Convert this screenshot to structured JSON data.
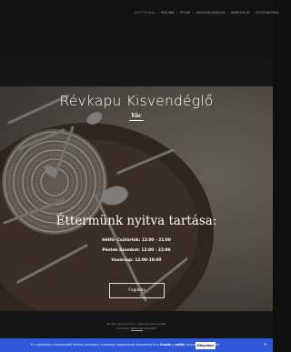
{
  "nav": {
    "items": [
      {
        "label": "Nyitóoldal"
      },
      {
        "label": "Rólunk"
      },
      {
        "label": "Étlap"
      },
      {
        "label": "Szolgáltatások"
      },
      {
        "label": "Kapcsolat"
      },
      {
        "label": "Fotógaléria"
      }
    ]
  },
  "hero": {
    "brand": "Révkapu Kisvendéglő",
    "city": "Vác",
    "hours_title": "Éttermünk nyitva tartása:",
    "hours": [
      "Hétfő- Csütörtök: 12:00 - 21:00",
      "Péntek-Szombat: 12:00 - 22:00",
      "Vasárnap: 12:00-18:00"
    ],
    "order_button": "Foglalás"
  },
  "footer": {
    "line1": "Minden jog fenntartva. | Révkapu Kisvendéglő",
    "line2_prefix": "Az oldalt a",
    "line2_link": "Webnode",
    "line2_suffix": "készítette"
  },
  "cookie": {
    "text_prefix": "Ez a weboldal a felhasználói élmény javítására, a webhely forgalmának elemzésére és a",
    "highlight1": "Cookie",
    "text_mid": "-k",
    "highlight2": "sütik",
    "text_suffix": "használatával működik.",
    "accept_label": "Elfogadom",
    "close_icon": "close-icon"
  },
  "colors": {
    "cookie_bar": "#2f58d8",
    "page_bg": "#0f0f0f"
  }
}
